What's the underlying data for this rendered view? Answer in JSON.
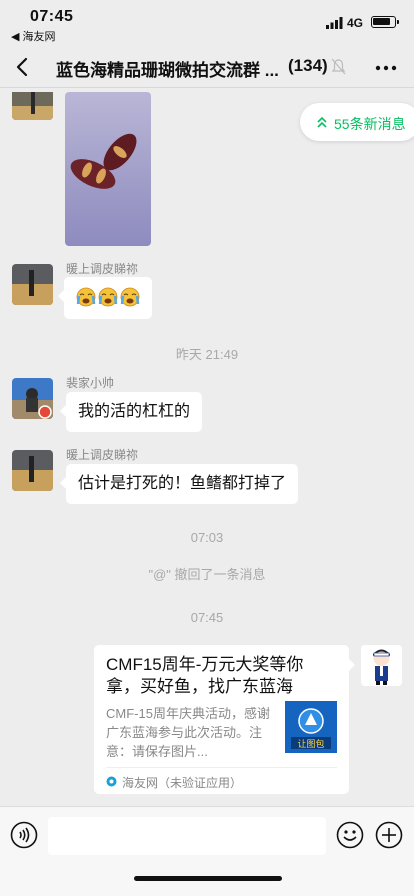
{
  "status_bar": {
    "time": "07:45",
    "back_app": "◀ 海友网",
    "network": "4G"
  },
  "header": {
    "title": "蓝色海精品珊瑚微拍交流群 ...",
    "member_count": "(134)"
  },
  "new_messages": {
    "label": "55条新消息"
  },
  "messages": [
    {
      "sender": "",
      "type": "image"
    },
    {
      "sender": "暖上调皮睇祢",
      "type": "emoji",
      "emojis": [
        "😭",
        "😭",
        "😭"
      ]
    },
    {
      "type": "timestamp",
      "text": "昨天 21:49"
    },
    {
      "sender": "裴家小帅",
      "type": "text",
      "text": "我的活的杠杠的"
    },
    {
      "sender": "暖上调皮睇祢",
      "type": "text",
      "text": "估计是打死的！鱼鳍都打掉了"
    },
    {
      "type": "timestamp",
      "text": "07:03"
    },
    {
      "type": "system",
      "text": "\"@\" 撤回了一条消息"
    },
    {
      "type": "timestamp",
      "text": "07:45"
    },
    {
      "type": "link_card",
      "title": "CMF15周年-万元大奖等你拿，买好鱼，找广东蓝海",
      "description": "CMF-15周年庆典活动，感谢广东蓝海参与此次活动。注意：请保存图片...",
      "source": "海友网（未验证应用）",
      "thumb_text": "让图包"
    }
  ],
  "colors": {
    "accent": "#07c160",
    "background": "#ededed",
    "bubble": "#ffffff"
  }
}
